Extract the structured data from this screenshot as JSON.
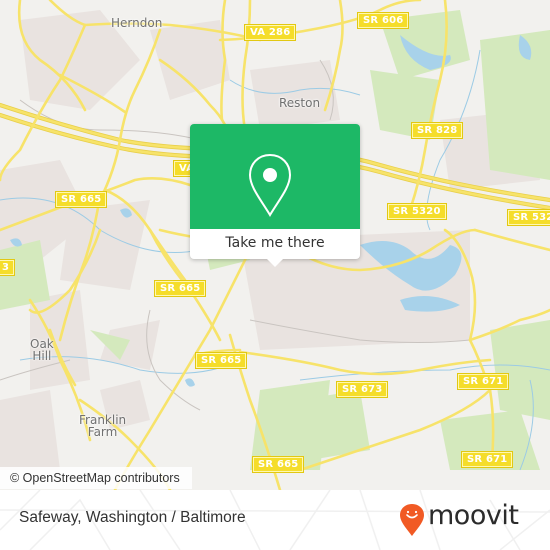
{
  "map": {
    "places": [
      {
        "name": "Herndon"
      },
      {
        "name": "Reston"
      },
      {
        "name": "Oak\nHill",
        "line1": "Oak",
        "line2": "Hill"
      },
      {
        "name": "Franklin Farm",
        "line1": "Franklin",
        "line2": "Farm"
      }
    ],
    "road_shields": [
      {
        "label": "VA 286"
      },
      {
        "label": "SR 606"
      },
      {
        "label": "SR 828"
      },
      {
        "label": "VA"
      },
      {
        "label": "SR 665"
      },
      {
        "label": "SR 5320"
      },
      {
        "label": "SR 532"
      },
      {
        "label": "3"
      },
      {
        "label": "SR 665"
      },
      {
        "label": "SR 665"
      },
      {
        "label": "SR 673"
      },
      {
        "label": "SR 671"
      },
      {
        "label": "SR 671"
      },
      {
        "label": "SR 665"
      }
    ],
    "attribution": "© OpenStreetMap contributors",
    "colors": {
      "background": "#f2f1ee",
      "road": "#f7e36a",
      "water": "#a9d3ea",
      "park": "#d2e8b8",
      "residential": "#e8e1de"
    }
  },
  "popup": {
    "icon": "map-pin-icon",
    "button_label": "Take me there",
    "accent_color": "#1db866"
  },
  "footer": {
    "title": "Safeway, Washington / Baltimore",
    "brand": "moovit",
    "brand_color": "#f15a24"
  }
}
